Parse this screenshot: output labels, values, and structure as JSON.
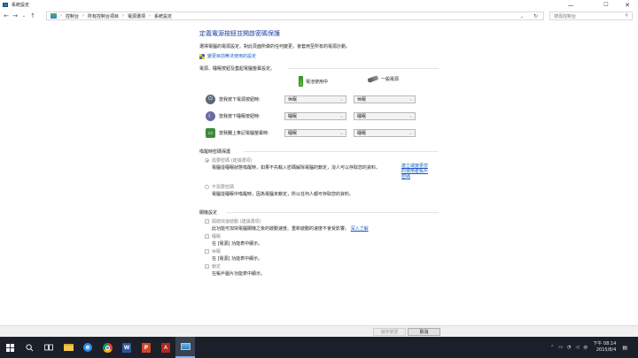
{
  "window": {
    "title": "系統設定"
  },
  "address": {
    "crumbs": [
      "控制台",
      "所有控制台項目",
      "電源選項",
      "系統設定"
    ],
    "search_placeholder": "搜尋控制台"
  },
  "main": {
    "heading": "定義電源按鈕並開啟密碼保護",
    "description": "選擇電腦的電源設定。對此頁面所做的任何變更，會套用至所有的電源計劃。",
    "admin_link": "變更目前無法使用的設定",
    "buttons_section": "電源、睡眠按鈕及蓋起電腦螢幕設定。",
    "col_battery": "電池使用中",
    "col_ac": "一般電源",
    "rows": [
      {
        "label": "當我按下電源按鈕時:",
        "battery": "休眠",
        "ac": "休眠"
      },
      {
        "label": "當我按下睡眠按鈕時:",
        "battery": "睡眠",
        "ac": "睡眠"
      },
      {
        "label": "當我闔上筆記電腦螢幕時:",
        "battery": "睡眠",
        "ac": "睡眠"
      }
    ],
    "password_section": "喚醒時密碼保護",
    "pw_require": "需要密碼 (建議選項)",
    "pw_require_desc": "電腦從睡眠狀態喚醒時，如果不先輸入密碼解除電腦的鎖定，沒人可以存取您的資料。",
    "pw_require_link": "建立或變更您的使用者帳戶密碼",
    "pw_none": "不需要密碼",
    "pw_none_desc": "電腦從睡眠中喚醒時，因為電腦未鎖定，所以任何人都可存取您的資料。",
    "shutdown_section": "關機設定",
    "fast_startup": "開啟快速啟動 (建議選項)",
    "fast_startup_desc": "此功能可加快電腦關機之後的啟動速度。重新啟動的速度不會受影響。",
    "fast_startup_link": "深入了解",
    "sleep_opt": "睡眠",
    "sleep_desc": "在 [電源] 功能表中顯示。",
    "hibernate_opt": "休眠",
    "hibernate_desc": "在 [電源] 功能表中顯示。",
    "lock_opt": "鎖定",
    "lock_desc": "在帳戶圖片功能表中顯示。"
  },
  "footer": {
    "save_label": "儲存變更",
    "cancel_label": "取消"
  },
  "taskbar": {
    "time": "下午 08:14",
    "date": "2015/8/4",
    "ime": "中"
  },
  "colors": {
    "heading": "#1a3e9e",
    "link": "#1a5bc0",
    "taskbar": "#1b1f2a"
  }
}
